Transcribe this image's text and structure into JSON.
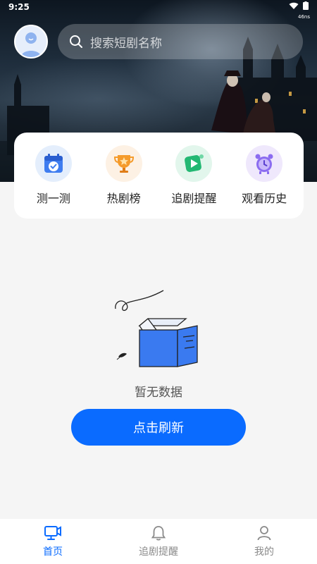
{
  "status_bar": {
    "time": "9:25",
    "network_speed": "46ns"
  },
  "header": {
    "search_placeholder": "搜索短剧名称"
  },
  "quick_menu": [
    {
      "label": "测一测",
      "icon": "calendar-check-icon"
    },
    {
      "label": "热剧榜",
      "icon": "trophy-icon"
    },
    {
      "label": "追剧提醒",
      "icon": "play-cube-icon"
    },
    {
      "label": "观看历史",
      "icon": "alarm-clock-icon"
    }
  ],
  "empty_state": {
    "message": "暂无数据",
    "refresh_label": "点击刷新",
    "illustration": "empty-box-icon"
  },
  "tabbar": [
    {
      "label": "首页",
      "icon": "tv-icon",
      "active": true
    },
    {
      "label": "追剧提醒",
      "icon": "bell-icon",
      "active": false
    },
    {
      "label": "我的",
      "icon": "person-icon",
      "active": false
    }
  ],
  "colors": {
    "accent": "#0a6bff",
    "background": "#f5f5f5",
    "card": "#ffffff"
  }
}
